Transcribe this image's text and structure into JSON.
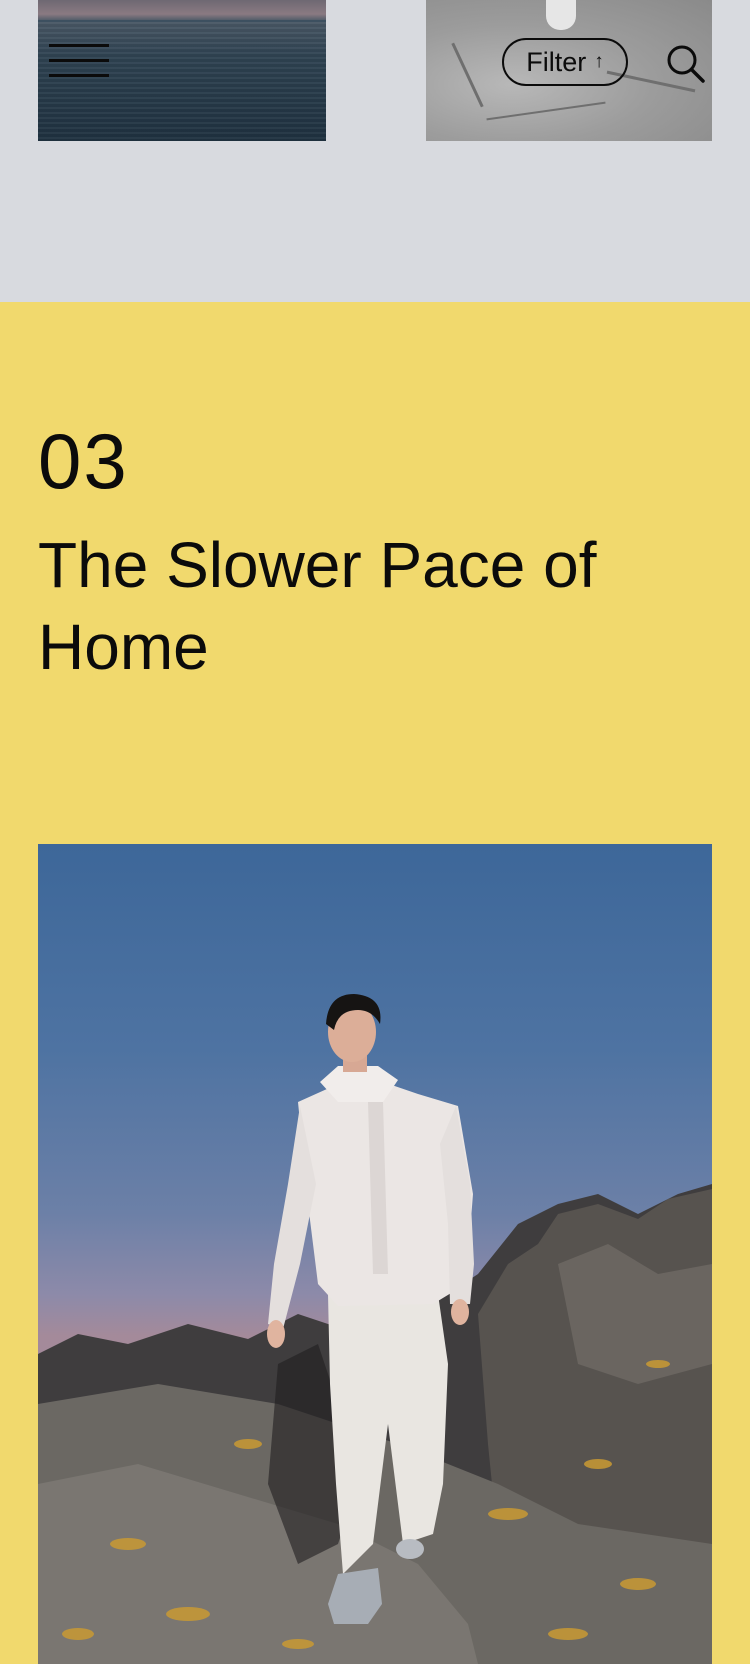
{
  "header": {
    "menu_label": "Menu",
    "filter_label": "Filter",
    "filter_arrow": "↑",
    "search_label": "Search"
  },
  "story": {
    "number": "03",
    "title": "The Slower Pace of Home"
  },
  "colors": {
    "background_gray": "#d8dadf",
    "section_yellow": "#f1d96d",
    "text": "#0b0b0b"
  },
  "icons": {
    "menu": "hamburger-icon",
    "filter": "arrow-up-icon",
    "search": "search-icon"
  }
}
